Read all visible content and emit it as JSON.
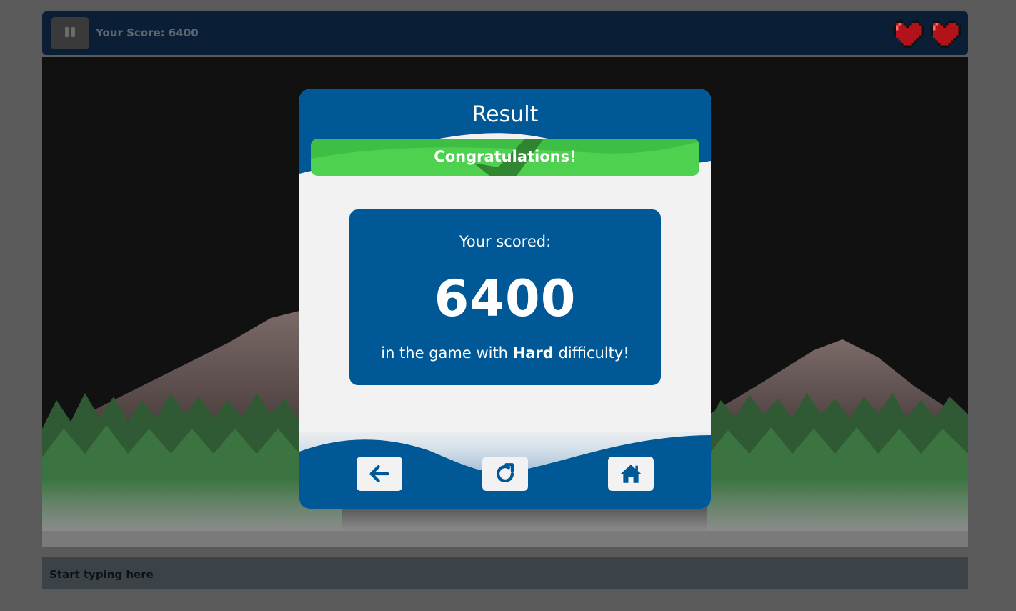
{
  "hud": {
    "score_text": "Your Score: 6400",
    "lives": 2,
    "pause_icon": "pause-icon",
    "heart_icon": "heart-icon"
  },
  "modal": {
    "title": "Result",
    "banner": "Congratulations!",
    "scored_label": "Your scored:",
    "score": "6400",
    "difficulty_prefix": "in the game with",
    "difficulty": "Hard",
    "difficulty_suffix": "difficulty!",
    "buttons": [
      {
        "icon": "arrow-left-icon"
      },
      {
        "icon": "redo-icon"
      },
      {
        "icon": "home-icon"
      }
    ]
  },
  "typing": {
    "placeholder": "Start typing here"
  },
  "colors": {
    "primary_blue": "#005896",
    "success_green": "#4fd150",
    "hud_bg": "#0a1f36",
    "heart_red": "#b2121a"
  }
}
